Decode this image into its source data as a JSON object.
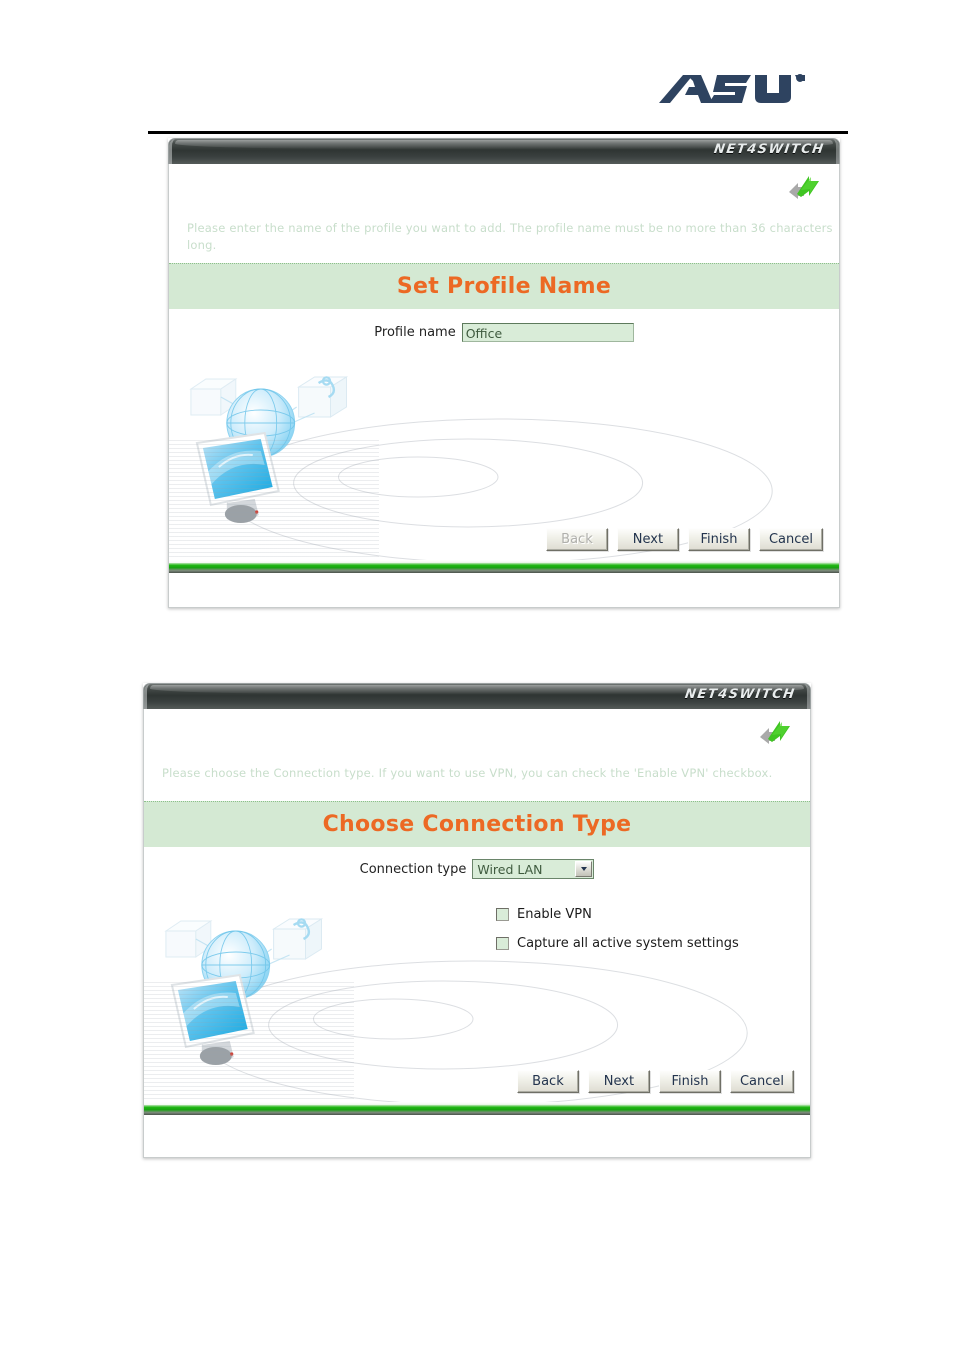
{
  "brand": {
    "company_logo": "asus-logo",
    "company_name": "ASUS",
    "app_name": "NET4SWITCH"
  },
  "colors": {
    "banner_bg": "#d4e9d3",
    "banner_title": "#ec6924",
    "instruction_text": "#c8decb",
    "field_bg": "#d9ecd8",
    "footer_green": "#13a40c",
    "asus_navy": "#2e4360",
    "arrow_green": "#3fc522"
  },
  "dialogs": [
    {
      "id": "set-profile-name",
      "titlebar_brand": "NET4SWITCH",
      "arrow_icon": "green-forward-arrow-icon",
      "instruction": "Please enter the name of the profile you want to add. The profile name must be no more than 36 characters long.",
      "banner_title": "Set Profile Name",
      "field": {
        "label": "Profile name",
        "value": "Office",
        "placeholder": "Profile name"
      },
      "illustration": "network-monitor-globe-illustration",
      "buttons": [
        {
          "label": "Back",
          "disabled": true
        },
        {
          "label": "Next",
          "disabled": false
        },
        {
          "label": "Finish",
          "disabled": false
        },
        {
          "label": "Cancel",
          "disabled": false
        }
      ]
    },
    {
      "id": "choose-connection-type",
      "titlebar_brand": "NET4SWITCH",
      "arrow_icon": "green-forward-arrow-icon",
      "instruction": "Please choose the Connection type. If you want to use VPN, you can check the 'Enable VPN' checkbox.",
      "banner_title": "Choose Connection Type",
      "field": {
        "label": "Connection type",
        "value": "Wired LAN",
        "options": [
          "Wired LAN"
        ]
      },
      "checkboxes": [
        {
          "label": "Enable VPN",
          "checked": false
        },
        {
          "label": "Capture all active system settings",
          "checked": false
        }
      ],
      "illustration": "network-monitor-globe-illustration",
      "buttons": [
        {
          "label": "Back",
          "disabled": false
        },
        {
          "label": "Next",
          "disabled": false
        },
        {
          "label": "Finish",
          "disabled": false
        },
        {
          "label": "Cancel",
          "disabled": false
        }
      ]
    }
  ]
}
